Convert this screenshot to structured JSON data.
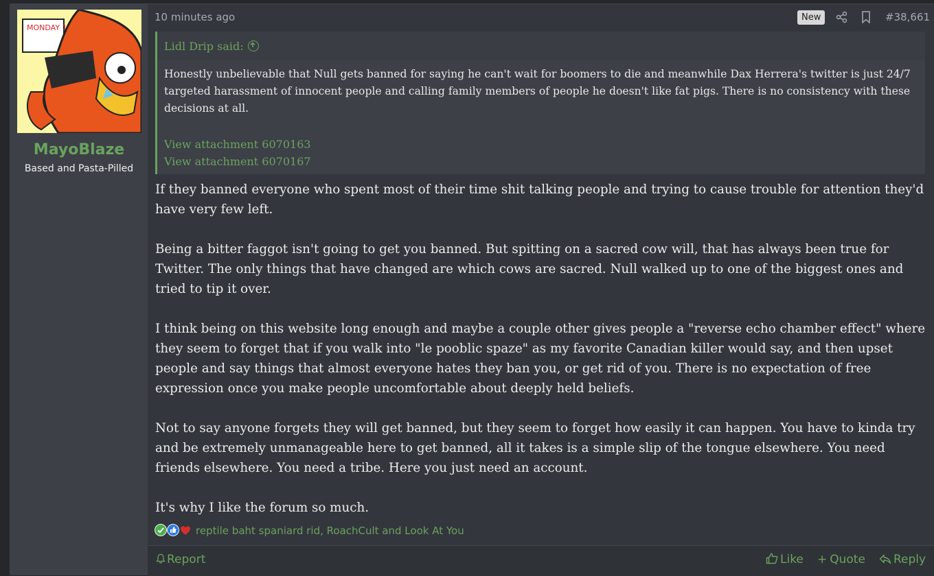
{
  "user": {
    "username": "MayoBlaze",
    "title": "Based and Pasta-Pilled",
    "avatar_text": "MONDAY 10"
  },
  "meta": {
    "time": "10 minutes ago",
    "badge": "New",
    "post_number": "#38,661"
  },
  "quote": {
    "author": "Lidl Drip said:",
    "text": "Honestly unbelievable that Null gets banned for saying he can't wait for boomers to die and meanwhile Dax Herrera's twitter is just 24/7 targeted harassment of innocent people and calling family members of people he doesn't like fat pigs. There is no consistency with these decisions at all.",
    "attachments": [
      "View attachment 6070163",
      "View attachment 6070167"
    ]
  },
  "body": {
    "paragraphs": [
      "If they banned everyone who spent most of their time shit talking people and trying to cause trouble for attention they'd have very few left.",
      "Being a bitter faggot isn't going to get you banned. But spitting on a sacred cow will, that has always been true for Twitter. The only things that have changed are which cows are sacred. Null walked up to one of the biggest ones and tried to tip it over.",
      "I think being on this website long enough and maybe a couple other gives people a \"reverse echo chamber effect\" where they seem to forget that if you walk into \"le pooblic spaze\" as my favorite Canadian killer would say, and then upset people and say things that almost everyone hates they ban you, or get rid of you. There is no expectation of free expression once you make people uncomfortable about deeply held beliefs.",
      "Not to say anyone forgets they will get banned, but they seem to forget how easily it can happen. You have to kinda try and be extremely unmanageable here to get banned, all it takes is a simple slip of the tongue elsewhere. You need friends elsewhere. You need a tribe. Here you just need an account.",
      "It's why I like the forum so much."
    ]
  },
  "reactions": {
    "icons": [
      "check-reaction-icon",
      "thumbs-up-reaction-icon",
      "heart-reaction-icon"
    ],
    "text": "reptile baht spaniard rid, RoachCult and Look At You"
  },
  "footer": {
    "report": "Report",
    "like": "Like",
    "quote": "Quote",
    "reply": "Reply"
  },
  "colors": {
    "accent": "#6aa35e",
    "background": "#33363c",
    "sidebar": "#3d4047"
  }
}
